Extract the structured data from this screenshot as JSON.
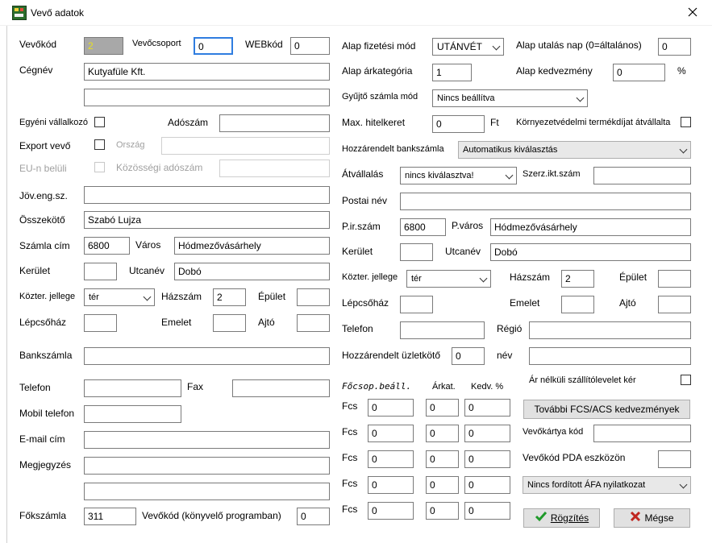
{
  "window": {
    "title": "Vevő adatok"
  },
  "left": {
    "vevokod": {
      "label": "Vevőkód",
      "value": "2"
    },
    "vevocsoport": {
      "label": "Vevőcsoport",
      "value": "0"
    },
    "webkod": {
      "label": "WEBkód",
      "value": "0"
    },
    "cegnev": {
      "label": "Cégnév",
      "value": "Kutyafüle Kft.",
      "value2": ""
    },
    "egyeni": {
      "label": "Egyéni vállalkozó"
    },
    "adoszam": {
      "label": "Adószám",
      "value": ""
    },
    "export": {
      "label": "Export vevő"
    },
    "orszag": {
      "label": "Ország",
      "value": ""
    },
    "eu": {
      "label": "EU-n belüli"
    },
    "kozossegi": {
      "label": "Közösségi adószám",
      "value": ""
    },
    "joveng": {
      "label": "Jöv.eng.sz.",
      "value": ""
    },
    "osszekoto": {
      "label": "Összekötő",
      "value": "Szabó Lujza"
    },
    "szamlacim": {
      "label": "Számla cím",
      "irsz": "6800",
      "varos_label": "Város",
      "varos": "Hódmezővásárhely"
    },
    "kerulet": {
      "label": "Kerület",
      "value": "",
      "utcanev_label": "Utcanév",
      "utcanev": "Dobó"
    },
    "kozter": {
      "label": "Közter. jellege",
      "value": "tér",
      "hazszam_label": "Házszám",
      "hazszam": "2",
      "epulet_label": "Épület",
      "epulet": ""
    },
    "lepcsohaz": {
      "label": "Lépcsőház",
      "value": "",
      "emelet_label": "Emelet",
      "emelet": "",
      "ajto_label": "Ajtó",
      "ajto": ""
    },
    "bankszamla": {
      "label": "Bankszámla",
      "value": ""
    },
    "telefon": {
      "label": "Telefon",
      "value": "",
      "fax_label": "Fax",
      "fax": ""
    },
    "mobil": {
      "label": "Mobil telefon",
      "value": ""
    },
    "email": {
      "label": "E-mail cím",
      "value": ""
    },
    "megjegyzes": {
      "label": "Megjegyzés",
      "value": "",
      "value2": ""
    },
    "fokszamla": {
      "label": "Főkszámla",
      "value": "311",
      "vevokod_k_label": "Vevőkód (könyvelő programban)",
      "vevokod_k": "0"
    }
  },
  "right": {
    "fizmod": {
      "label": "Alap fizetési mód",
      "value": "UTÁNVÉT"
    },
    "utalasnap": {
      "label": "Alap utalás nap (0=általános)",
      "value": "0"
    },
    "arkategoria": {
      "label": "Alap árkategória",
      "value": "1"
    },
    "kedvezmeny": {
      "label": "Alap kedvezmény",
      "value": "0",
      "unit": "%"
    },
    "gyujto": {
      "label": "Gyűjtő számla mód",
      "value": "Nincs beállítva"
    },
    "hitelkeret": {
      "label": "Max. hitelkeret",
      "value": "0",
      "unit": "Ft"
    },
    "kornyezet": {
      "label": "Környezetvédelmi termékdíjat átvállalta"
    },
    "bankszamla": {
      "label": "Hozzárendelt bankszámla",
      "value": "Automatikus kiválasztás"
    },
    "atvallalas": {
      "label": "Átvállalás",
      "value": "nincs kiválasztva!",
      "szerz_label": "Szerz.ikt.szám",
      "szerz": ""
    },
    "postai": {
      "label": "Postai név",
      "value": ""
    },
    "pirszam": {
      "label": "P.ir.szám",
      "value": "6800",
      "pvaros_label": "P.város",
      "pvaros": "Hódmezővásárhely"
    },
    "kerulet": {
      "label": "Kerület",
      "value": "",
      "utcanev_label": "Utcanév",
      "utcanev": "Dobó"
    },
    "kozter": {
      "label": "Közter. jellege",
      "value": "tér",
      "hazszam_label": "Házszám",
      "hazszam": "2",
      "epulet_label": "Épület",
      "epulet": ""
    },
    "lepcsohaz": {
      "label": "Lépcsőház",
      "value": "",
      "emelet_label": "Emelet",
      "emelet": "",
      "ajto_label": "Ajtó",
      "ajto": ""
    },
    "telefon": {
      "label": "Telefon",
      "value": "",
      "regio_label": "Régió",
      "regio": ""
    },
    "uzletkoto": {
      "label": "Hozzárendelt üzletkötő",
      "value": "0",
      "nev_label": "név",
      "nev": ""
    },
    "szallito": {
      "label": "Ár nélküli szállítólevelet kér"
    },
    "fcs": {
      "header": "Főcsop.beáll.",
      "arkat_header": "Árkat.",
      "kedv_header": "Kedv. %",
      "row_label": "Fcs",
      "rows": [
        {
          "fcs": "0",
          "arkat": "0",
          "kedv": "0"
        },
        {
          "fcs": "0",
          "arkat": "0",
          "kedv": "0"
        },
        {
          "fcs": "0",
          "arkat": "0",
          "kedv": "0"
        },
        {
          "fcs": "0",
          "arkat": "0",
          "kedv": "0"
        },
        {
          "fcs": "0",
          "arkat": "0",
          "kedv": "0"
        }
      ]
    },
    "tovabbi_button": "További FCS/ACS kedvezmények",
    "vevokartya": {
      "label": "Vevőkártya kód",
      "value": ""
    },
    "pda": {
      "label": "Vevőkód PDA eszközön",
      "value": ""
    },
    "afa": {
      "value": "Nincs fordított ÁFA nyilatkozat"
    },
    "rogzites_button": "Rögzítés",
    "megse_button": "Mégse"
  },
  "colors": {
    "accent": "#2f7de0",
    "ok_green": "#1f9a2a",
    "cancel_red": "#c0261f"
  }
}
